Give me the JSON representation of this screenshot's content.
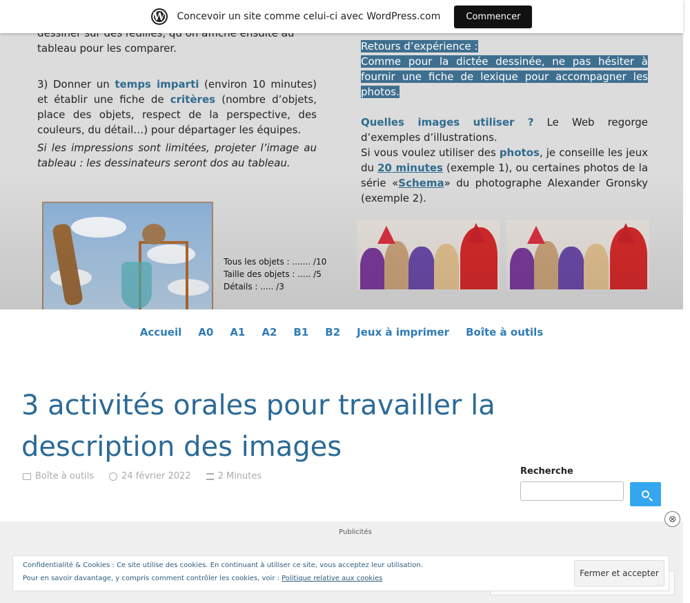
{
  "wpbar": {
    "logo": "W",
    "text": "Concevoir un site comme celui-ci avec WordPress.com",
    "button": "Commencer"
  },
  "header": {
    "left": {
      "line0": "dessiner sur des feuilles, qu’on affiche ensuite au",
      "line1": "tableau pour les comparer.",
      "p2_a": "3) Donner un ",
      "p2_hl1": "temps imparti",
      "p2_b": " (environ 10 minutes) et établir une fiche de ",
      "p2_hl2": "critères",
      "p2_c": " (nombre d’objets, place des objets, respect de la perspective, des couleurs, du détail…) pour départager les équipes.",
      "p3": "Si les impressions sont limitées, projeter l’image au tableau : les dessinateurs seront dos au tableau."
    },
    "right": {
      "sel1": "Retours d’expérience :",
      "sel2": "Comme pour la dictée dessinée, ne pas hésiter à fournir une fiche de lexique pour accompagner les photos.",
      "q_hl": "Quelles images utiliser ?",
      "q_rest": " Le Web regorge d’exemples d’illustrations.",
      "p_a": "Si vous voulez utiliser des ",
      "p_hl": "photos",
      "p_b": ", je conseille les jeux du ",
      "p_link1": "20 minutes",
      "p_c": " (exemple 1), ou certaines photos de la  série «",
      "p_link2": "Schema",
      "p_d": "» du photographe Alexander Gronsky (exemple 2)."
    },
    "scores": [
      "Tous les objets : ....... /10",
      "Taille des objets : ..... /5",
      "Détails : ..... /3"
    ]
  },
  "nav": [
    "Accueil",
    "A0",
    "A1",
    "A2",
    "B1",
    "B2",
    "Jeux à imprimer",
    "Boîte à outils"
  ],
  "post": {
    "title": "3 activités orales pour travailler la description des images",
    "category": "Boîte à outils",
    "date": "24 février 2022",
    "reading": "2 Minutes"
  },
  "search": {
    "label": "Recherche",
    "placeholder": ""
  },
  "ads": {
    "label": "Publicités",
    "close": "⊗"
  },
  "cookie": {
    "line1": "Confidentialité & Cookies : Ce site utilise des cookies. En continuant à utiliser ce site, vous acceptez leur utilisation.",
    "line2_pre": "Pour en savoir davantage, y compris comment contrôler les cookies, voir : ",
    "line2_link": "Politique relative aux cookies",
    "button": "Fermer et accepter"
  },
  "colors": {
    "accent": "#2f7bb5",
    "title": "#2b6a96",
    "search_btn": "#35a7f0"
  }
}
